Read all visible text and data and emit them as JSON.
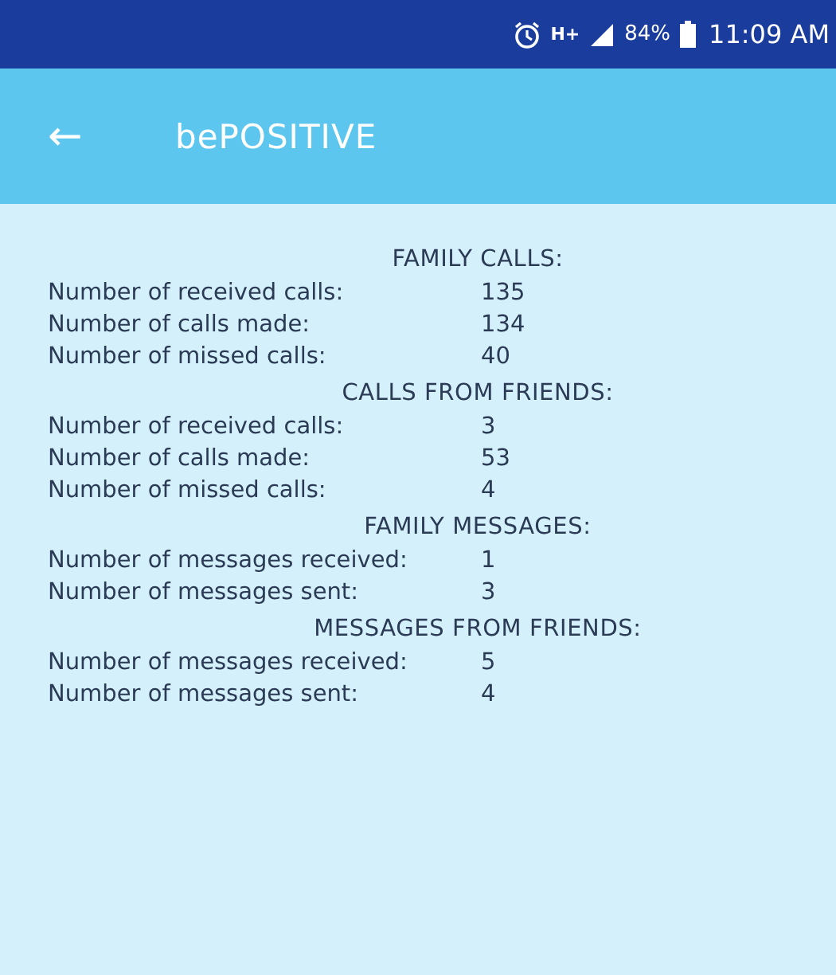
{
  "status_bar": {
    "network": "H+",
    "battery": "84%",
    "time": "11:09 AM"
  },
  "app_bar": {
    "back": "←",
    "title": "bePOSITIVE"
  },
  "sections": [
    {
      "title": "FAMILY CALLS:",
      "rows": [
        {
          "label": "Number of received calls:",
          "value": "135"
        },
        {
          "label": "Number of calls made:",
          "value": "134"
        },
        {
          "label": "Number of missed calls:",
          "value": "40"
        }
      ]
    },
    {
      "title": "CALLS FROM FRIENDS:",
      "rows": [
        {
          "label": "Number of received calls:",
          "value": "3"
        },
        {
          "label": "Number of calls made:",
          "value": "53"
        },
        {
          "label": "Number of missed calls:",
          "value": "4"
        }
      ]
    },
    {
      "title": "FAMILY MESSAGES:",
      "rows": [
        {
          "label": "Number of messages received:",
          "value": "1"
        },
        {
          "label": "Number of messages sent:",
          "value": "3"
        }
      ]
    },
    {
      "title": "MESSAGES FROM FRIENDS:",
      "rows": [
        {
          "label": "Number of messages received:",
          "value": "5"
        },
        {
          "label": "Number of messages sent:",
          "value": "4"
        }
      ]
    }
  ]
}
